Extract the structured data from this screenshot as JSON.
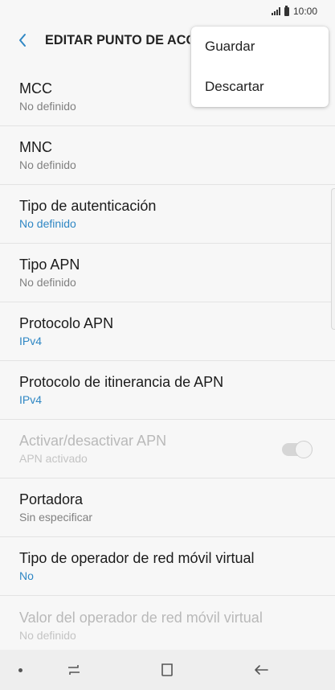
{
  "status_bar": {
    "time": "10:00",
    "icons": [
      "signal-icon",
      "battery-icon"
    ]
  },
  "header": {
    "back_icon": "arrow-left-icon",
    "title": "EDITAR PUNTO DE ACCESO",
    "accent_color": "#2f87c4"
  },
  "menu": {
    "items": [
      {
        "label": "Guardar"
      },
      {
        "label": "Descartar"
      }
    ]
  },
  "settings": [
    {
      "title": "MCC",
      "value": "No definido"
    },
    {
      "title": "MNC",
      "value": "No definido"
    },
    {
      "title": "Tipo de autenticación",
      "value": "No definido"
    },
    {
      "title": "Tipo APN",
      "value": "No definido"
    },
    {
      "title": "Protocolo APN",
      "value": "IPv4"
    },
    {
      "title": "Protocolo de itinerancia de APN",
      "value": "IPv4"
    },
    {
      "title": "Activar/desactivar APN",
      "value": "APN activado"
    },
    {
      "title": "Portadora",
      "value": "Sin especificar"
    },
    {
      "title": "Tipo de operador de red móvil virtual",
      "value": "No"
    },
    {
      "title": "Valor del operador de red móvil virtual",
      "value": "No definido"
    }
  ],
  "toggle": {
    "apn_enabled": true,
    "disabled": true
  },
  "nav_bar": {
    "icons": [
      "dot-icon",
      "recent-apps-icon",
      "home-icon",
      "back-icon"
    ]
  }
}
